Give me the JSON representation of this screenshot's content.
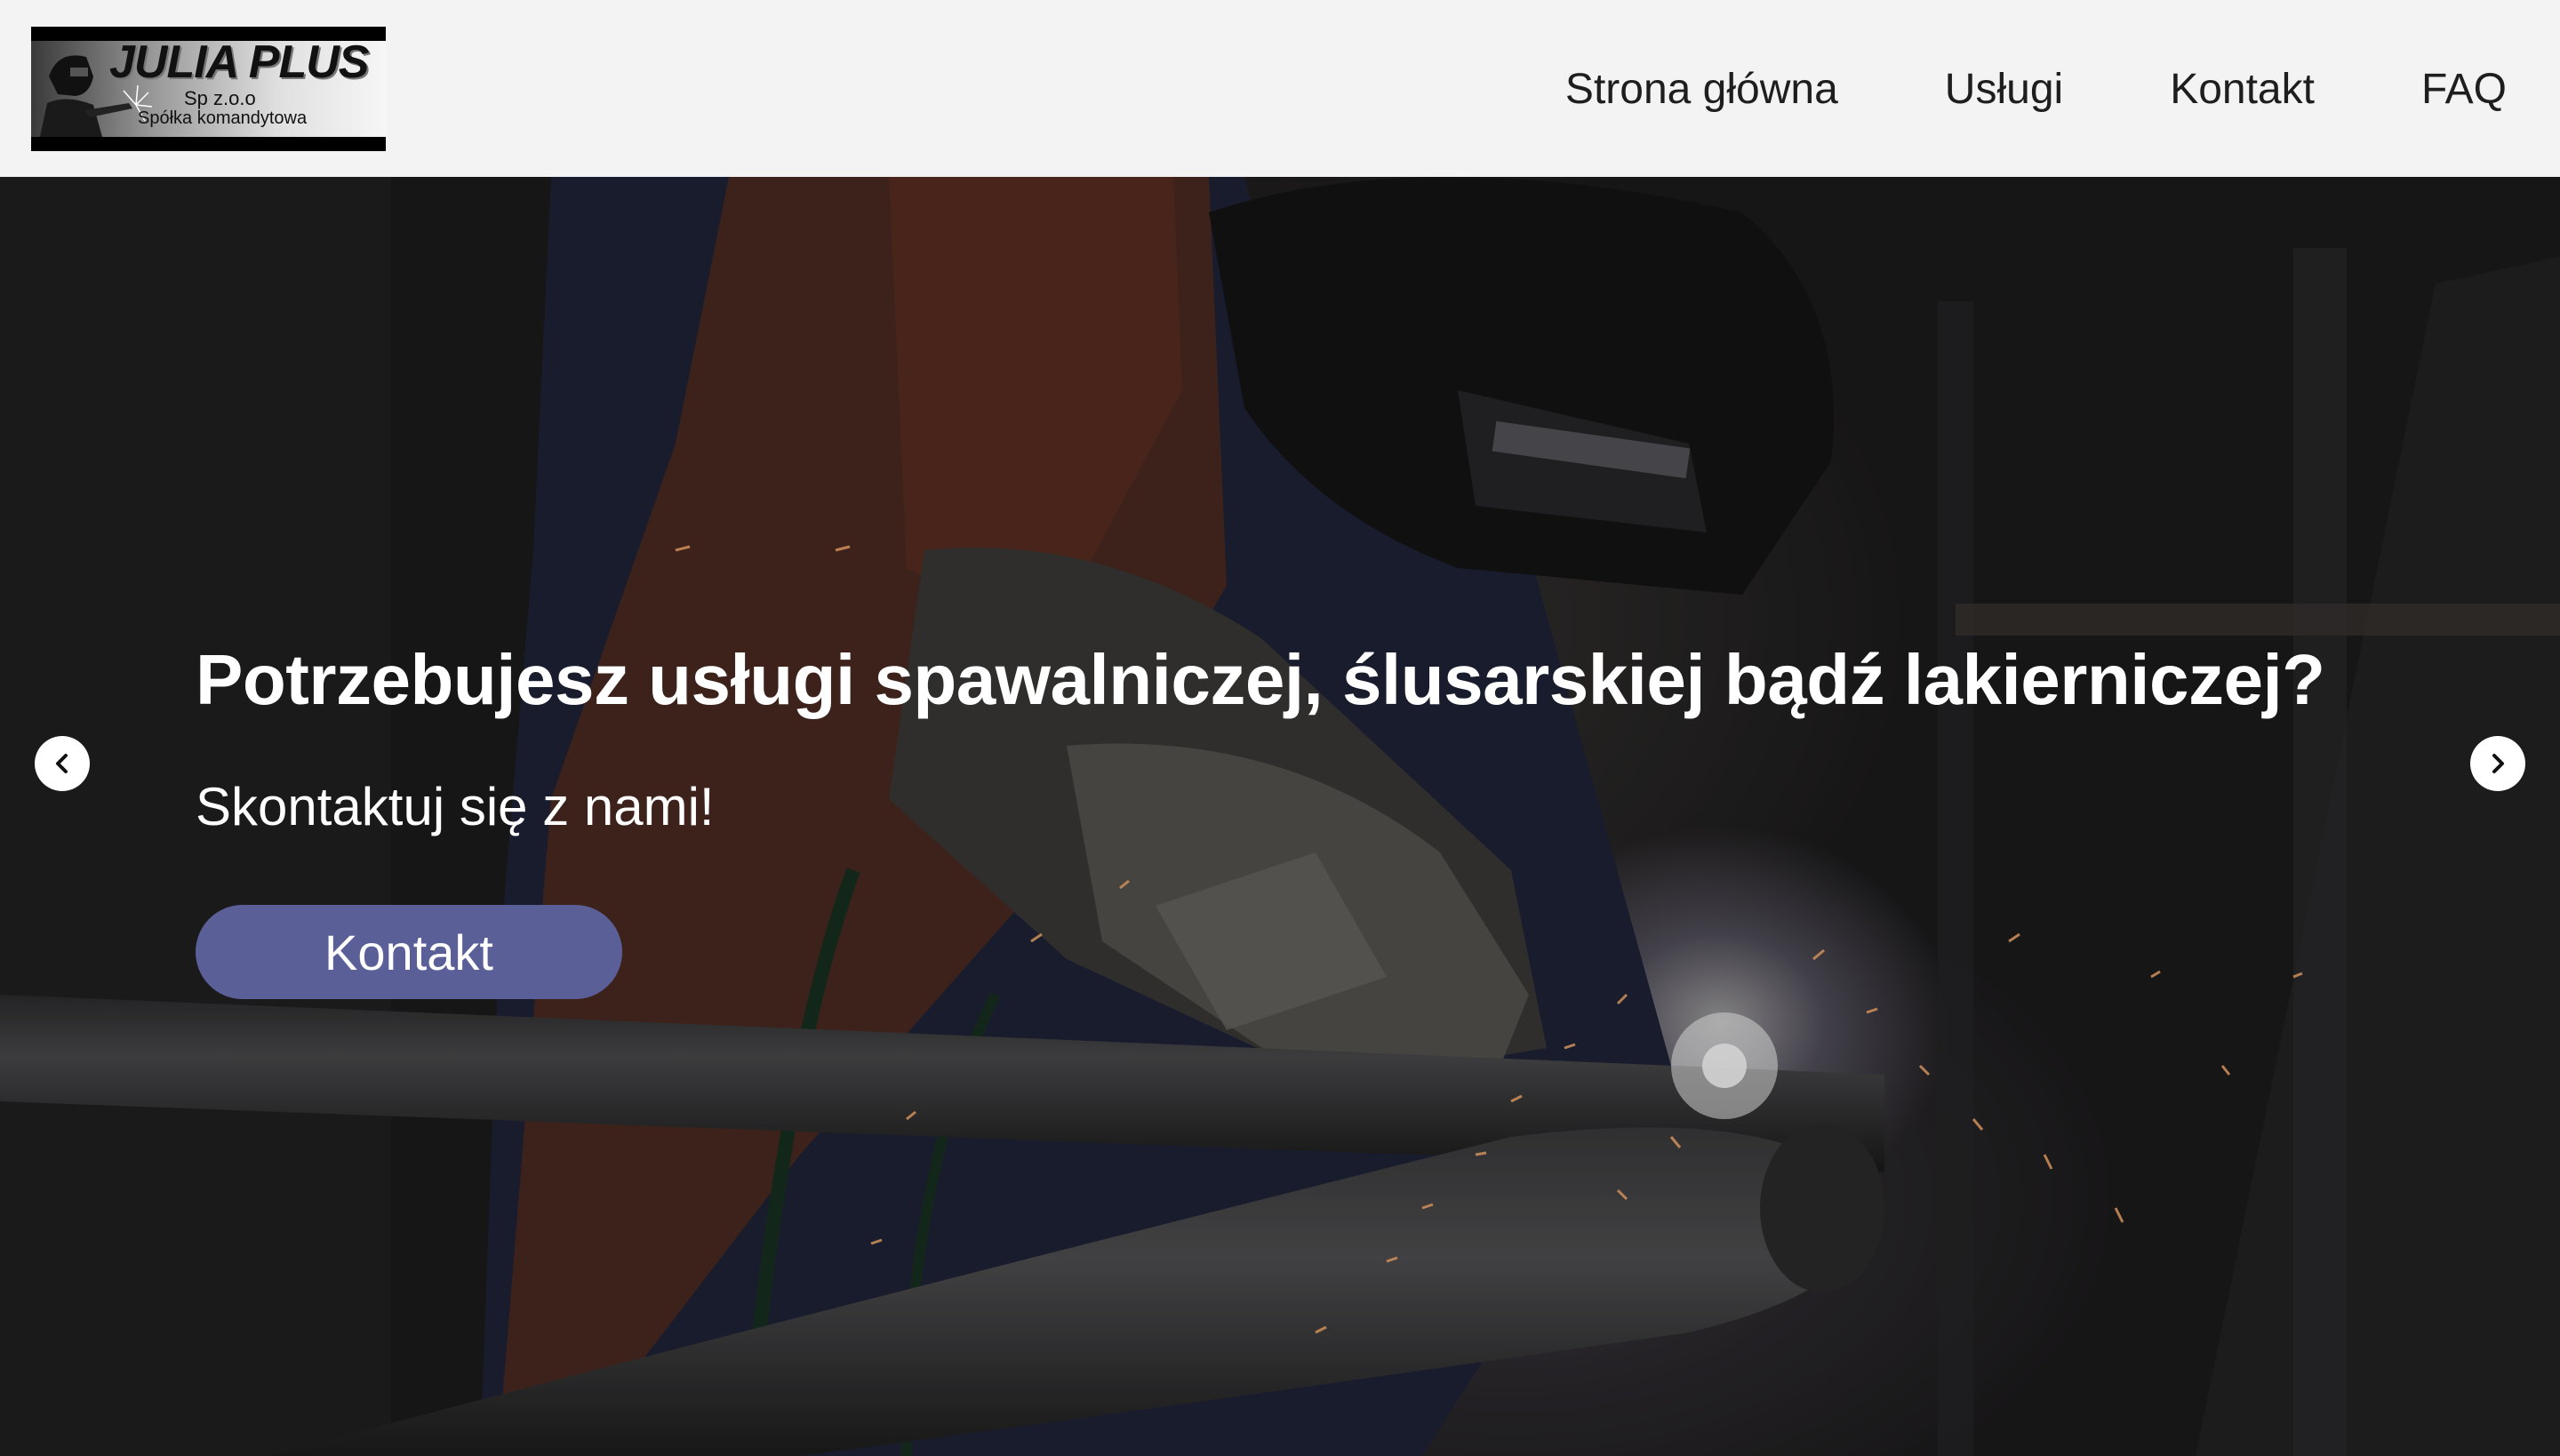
{
  "logo": {
    "name": "JULIA PLUS",
    "line1": "Sp z.o.o",
    "line2": "Spółka komandytowa"
  },
  "nav": {
    "items": [
      {
        "label": "Strona główna"
      },
      {
        "label": "Usługi"
      },
      {
        "label": "Kontakt"
      },
      {
        "label": "FAQ"
      }
    ]
  },
  "hero": {
    "title": "Potrzebujesz usługi spawalniczej, ślusarskiej bądź lakierniczej?",
    "subtitle": "Skontaktuj się z nami!",
    "button_label": "Kontakt",
    "button_color": "#5a5f98",
    "prev_icon": "chevron-left-icon",
    "next_icon": "chevron-right-icon"
  }
}
